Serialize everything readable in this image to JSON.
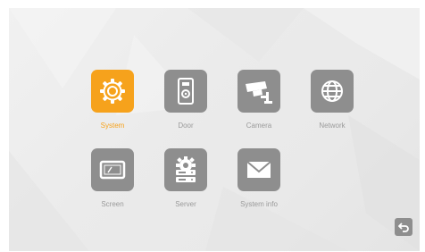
{
  "menu": {
    "items": [
      {
        "label": "System",
        "icon": "gear-icon",
        "selected": true
      },
      {
        "label": "Door",
        "icon": "door-station-icon",
        "selected": false
      },
      {
        "label": "Camera",
        "icon": "cctv-camera-icon",
        "selected": false
      },
      {
        "label": "Network",
        "icon": "globe-icon",
        "selected": false
      },
      {
        "label": "Screen",
        "icon": "screen-icon",
        "selected": false
      },
      {
        "label": "Server",
        "icon": "server-gear-icon",
        "selected": false
      },
      {
        "label": "System info",
        "icon": "envelope-icon",
        "selected": false
      }
    ]
  },
  "back_button": {
    "icon": "back-arrow-icon"
  },
  "colors": {
    "accent": "#f6a21c",
    "tile": "#8e8e8e",
    "label": "#9a9a9a",
    "background": "#ececec"
  }
}
